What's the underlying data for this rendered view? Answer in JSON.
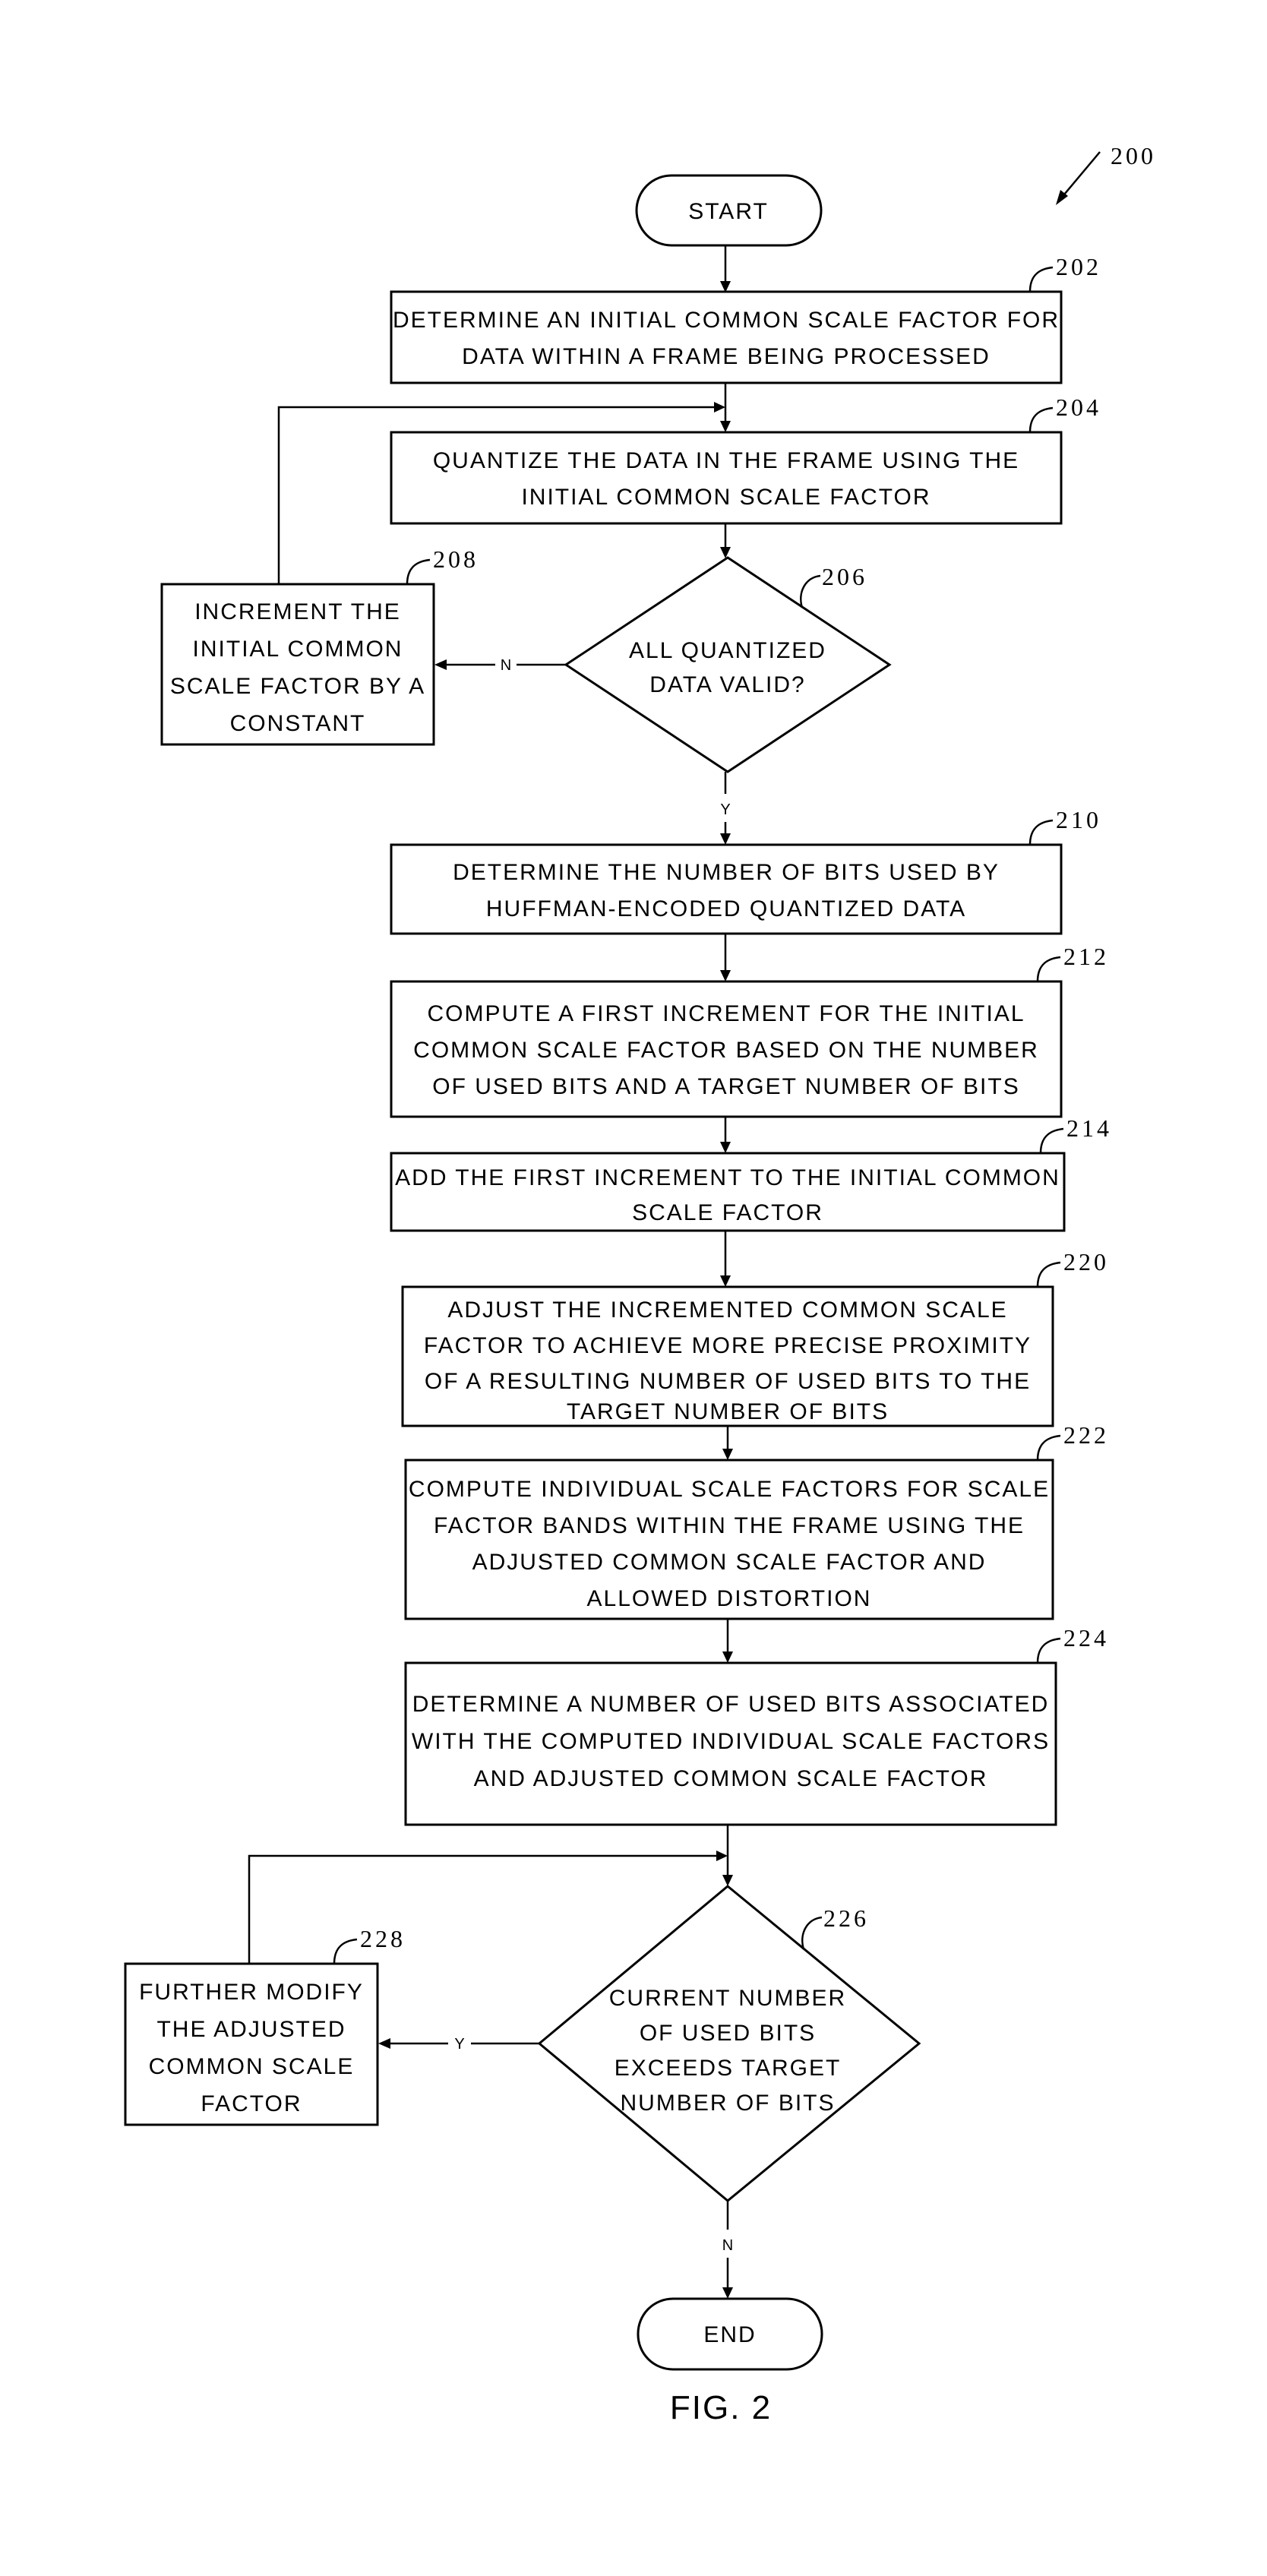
{
  "figure": {
    "number_label": "200",
    "caption": "FIG. 2"
  },
  "terminals": {
    "start": "START",
    "end": "END"
  },
  "steps": [
    {
      "id": "202",
      "lines": [
        "DETERMINE AN INITIAL COMMON SCALE FACTOR FOR",
        "DATA WITHIN A FRAME BEING PROCESSED"
      ]
    },
    {
      "id": "204",
      "lines": [
        "QUANTIZE THE DATA IN THE FRAME USING THE",
        "INITIAL COMMON SCALE FACTOR"
      ]
    },
    {
      "id": "206",
      "type": "decision",
      "lines": [
        "ALL QUANTIZED",
        "DATA VALID?"
      ]
    },
    {
      "id": "208",
      "lines": [
        "INCREMENT THE",
        "INITIAL COMMON",
        "SCALE FACTOR BY A",
        "CONSTANT"
      ]
    },
    {
      "id": "210",
      "lines": [
        "DETERMINE THE NUMBER OF BITS USED BY",
        "HUFFMAN-ENCODED QUANTIZED DATA"
      ]
    },
    {
      "id": "212",
      "lines": [
        "COMPUTE A FIRST INCREMENT FOR THE INITIAL",
        "COMMON SCALE FACTOR BASED ON THE NUMBER",
        "OF USED BITS AND A TARGET NUMBER OF BITS"
      ]
    },
    {
      "id": "214",
      "lines": [
        "ADD THE FIRST INCREMENT TO THE INITIAL COMMON",
        "SCALE FACTOR"
      ]
    },
    {
      "id": "220",
      "lines": [
        "ADJUST THE INCREMENTED COMMON SCALE",
        "FACTOR TO ACHIEVE MORE PRECISE PROXIMITY",
        "OF A RESULTING NUMBER OF USED BITS TO THE",
        "TARGET NUMBER OF BITS"
      ]
    },
    {
      "id": "222",
      "lines": [
        "COMPUTE INDIVIDUAL SCALE FACTORS FOR SCALE",
        "FACTOR BANDS WITHIN THE FRAME USING THE",
        "ADJUSTED COMMON SCALE FACTOR AND",
        "ALLOWED DISTORTION"
      ]
    },
    {
      "id": "224",
      "lines": [
        "DETERMINE A NUMBER OF USED BITS ASSOCIATED",
        "WITH THE COMPUTED INDIVIDUAL SCALE FACTORS",
        "AND ADJUSTED COMMON SCALE FACTOR"
      ]
    },
    {
      "id": "226",
      "type": "decision",
      "lines": [
        "CURRENT NUMBER",
        "OF USED BITS",
        "EXCEEDS TARGET",
        "NUMBER OF BITS"
      ]
    },
    {
      "id": "228",
      "lines": [
        "FURTHER MODIFY",
        "THE ADJUSTED",
        "COMMON SCALE",
        "FACTOR"
      ]
    }
  ],
  "branch_labels": {
    "d206_no": "N",
    "d206_yes": "Y",
    "d226_yes": "Y",
    "d226_no": "N"
  }
}
